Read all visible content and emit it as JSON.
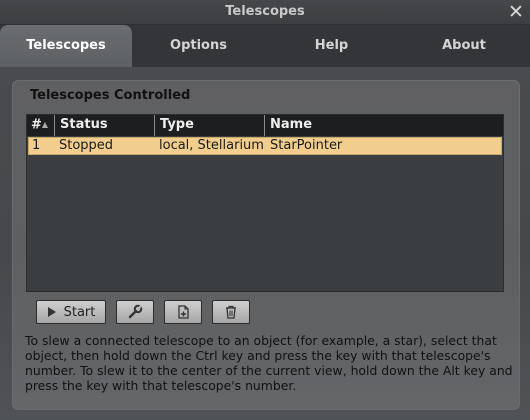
{
  "window": {
    "title": "Telescopes",
    "close_symbol": "✕"
  },
  "tabs": [
    {
      "label": "Telescopes",
      "active": true
    },
    {
      "label": "Options",
      "active": false
    },
    {
      "label": "Help",
      "active": false
    },
    {
      "label": "About",
      "active": false
    }
  ],
  "panel": {
    "title": "Telescopes Controlled"
  },
  "table": {
    "columns": [
      "#",
      "Status",
      "Type",
      "Name"
    ],
    "sort_icon": "▲",
    "rows": [
      {
        "num": "1",
        "status": "Stopped",
        "type": "local, Stellarium",
        "name": "StarPointer",
        "selected": true
      }
    ]
  },
  "toolbar": {
    "start_label": "Start",
    "icons": [
      "play-icon",
      "wrench-icon",
      "add-document-icon",
      "trash-icon"
    ]
  },
  "help_text": "To slew a connected telescope to an object (for example, a star), select that object, then hold down the Ctrl key and press the key with that telescope's number. To slew it to the center of the current view, hold down the Alt key and press the key with that telescope's number.",
  "colors": {
    "selected_row": "#f2ce8e",
    "table_bg": "#3b3e41",
    "header_bg": "#1c1e20"
  }
}
